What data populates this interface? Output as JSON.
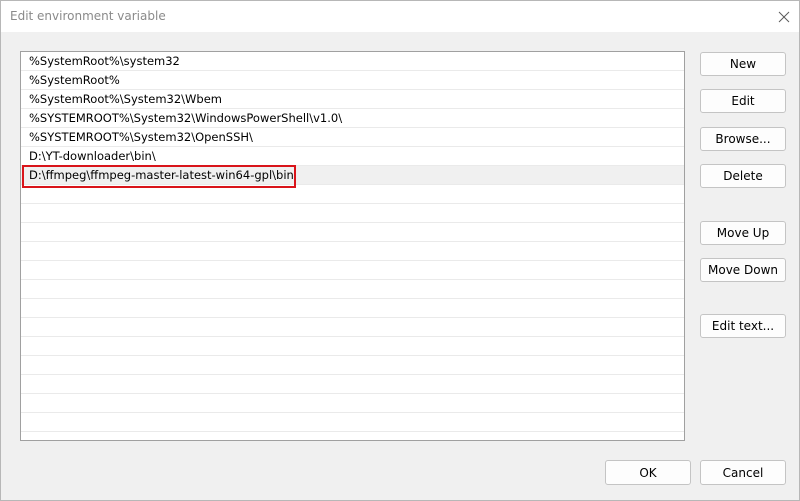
{
  "window": {
    "title": "Edit environment variable"
  },
  "list": {
    "rows": [
      "%SystemRoot%\\system32",
      "%SystemRoot%",
      "%SystemRoot%\\System32\\Wbem",
      "%SYSTEMROOT%\\System32\\WindowsPowerShell\\v1.0\\",
      "%SYSTEMROOT%\\System32\\OpenSSH\\",
      "D:\\YT-downloader\\bin\\",
      "D:\\ffmpeg\\ffmpeg-master-latest-win64-gpl\\bin",
      "",
      "",
      "",
      "",
      "",
      "",
      "",
      "",
      "",
      "",
      "",
      "",
      ""
    ],
    "selected_index": 6
  },
  "buttons": {
    "new": "New",
    "edit": "Edit",
    "browse": "Browse...",
    "delete": "Delete",
    "move_up": "Move Up",
    "move_down": "Move Down",
    "edit_text": "Edit text...",
    "ok": "OK",
    "cancel": "Cancel"
  },
  "colors": {
    "highlight": "#d9141a",
    "selected_row": "#f0f0f0"
  }
}
